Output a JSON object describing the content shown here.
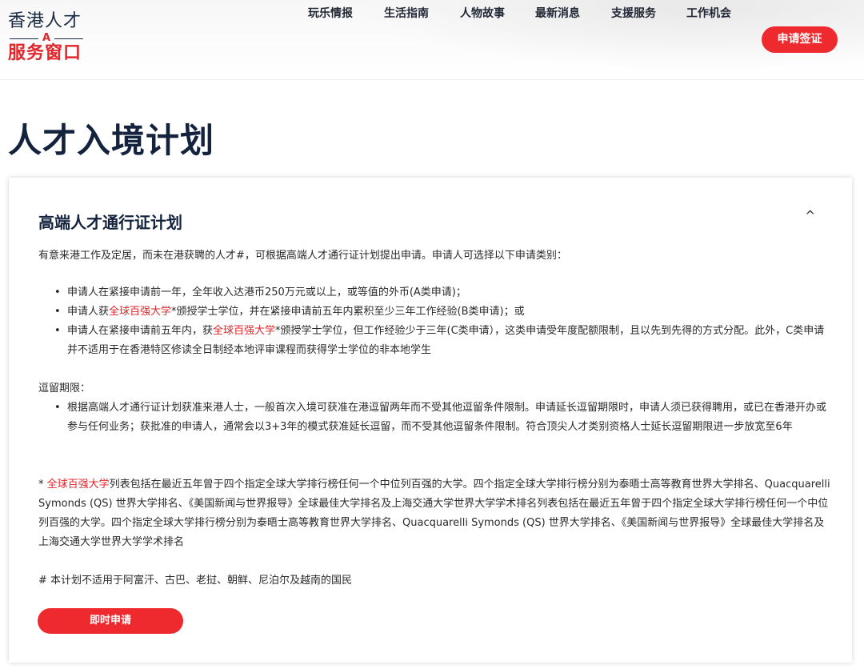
{
  "logo": {
    "line1": "香港人才",
    "mark": "A",
    "line2": "服务窗口"
  },
  "nav": {
    "items": [
      "玩乐情报",
      "生活指南",
      "人物故事",
      "最新消息",
      "支援服务",
      "工作机会"
    ],
    "apply_label": "申请签证"
  },
  "page": {
    "title": "人才入境计划"
  },
  "section": {
    "title": "高端人才通行证计划",
    "collapse_icon": "^",
    "intro": "有意来港工作及定居，而未在港获聘的人才#，可根据高端人才通行证计划提出申请。申请人可选择以下申请类别：",
    "categories": {
      "a": "申请人在紧接申请前一年，全年收入达港币250万元或以上，或等值的外币(A类申请)；",
      "b_pre": "申请人获",
      "b_link": "全球百强大学",
      "b_post": "*颁授学士学位，并在紧接申请前五年内累积至少三年工作经验(B类申请)；或",
      "c_pre": "申请人在紧接申请前五年内，获",
      "c_link": "全球百强大学",
      "c_post": "*颁授学士学位，但工作经验少于三年(C类申请），这类申请受年度配额限制，且以先到先得的方式分配。此外，C类申请并不适用于在香港特区修读全日制经本地评审课程而获得学士学位的非本地学生"
    },
    "stay_label": "逗留期限：",
    "stay_text": "根据高端人才通行证计划获准来港人士，一般首次入境可获准在港逗留两年而不受其他逗留条件限制。申请延长逗留期限时，申请人须已获得聘用，或已在香港开办或参与任何业务；获批准的申请人，通常会以3+3年的模式获准延长逗留，而不受其他逗留条件限制。符合顶尖人才类别资格人士延长逗留期限进一步放宽至6年",
    "footnote_star": "* ",
    "footnote_link": "全球百强大学",
    "footnote_text": "列表包括在最近五年曾于四个指定全球大学排行榜任何一个中位列百强的大学。四个指定全球大学排行榜分别为泰晤士高等教育世界大学排名、Quacquarelli Symonds (QS) 世界大学排名、《美国新闻与世界报导》全球最佳大学排名及上海交通大学世界大学学术排名列表包括在最近五年曾于四个指定全球大学排行榜任何一个中位列百强的大学。四个指定全球大学排行榜分别为泰晤士高等教育世界大学排名、Quacquarelli Symonds (QS) 世界大学排名、《美国新闻与世界报导》全球最佳大学排名及上海交通大学世界大学学术排名",
    "hash_note": "# 本计划不适用于阿富汗、古巴、老挝、朝鲜、尼泊尔及越南的国民",
    "cta_label": "即时申请"
  },
  "colors": {
    "accent": "#ef2a2f",
    "navy": "#13223d"
  }
}
